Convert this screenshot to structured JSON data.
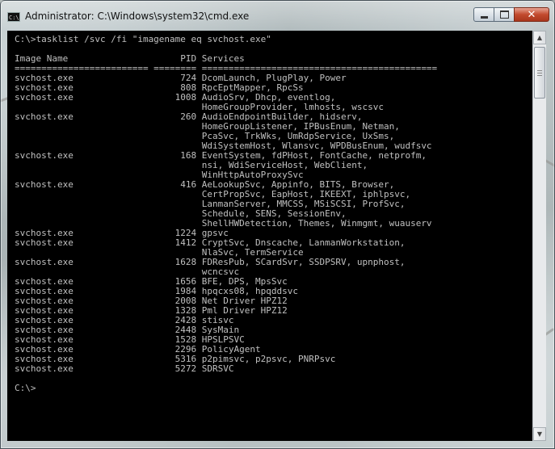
{
  "window": {
    "title": "Administrator: C:\\Windows\\system32\\cmd.exe",
    "icon": "cmd-console-icon",
    "icon_label": "C:\\"
  },
  "caption_buttons": {
    "minimize_icon": "minimize-icon",
    "maximize_icon": "maximize-icon",
    "close_icon": "close-icon",
    "close_glyph": "✕"
  },
  "console": {
    "lines": [
      "C:\\>tasklist /svc /fi \"imagename eq svchost.exe\"",
      "",
      "Image Name                     PID Services",
      "========================= ======== ============================================",
      "svchost.exe                    724 DcomLaunch, PlugPlay, Power",
      "svchost.exe                    808 RpcEptMapper, RpcSs",
      "svchost.exe                   1008 AudioSrv, Dhcp, eventlog,",
      "                                   HomeGroupProvider, lmhosts, wscsvc",
      "svchost.exe                    260 AudioEndpointBuilder, hidserv,",
      "                                   HomeGroupListener, IPBusEnum, Netman,",
      "                                   PcaSvc, TrkWks, UmRdpService, UxSms,",
      "                                   WdiSystemHost, Wlansvc, WPDBusEnum, wudfsvc",
      "svchost.exe                    168 EventSystem, fdPHost, FontCache, netprofm,",
      "                                   nsi, WdiServiceHost, WebClient,",
      "                                   WinHttpAutoProxySvc",
      "svchost.exe                    416 AeLookupSvc, Appinfo, BITS, Browser,",
      "                                   CertPropSvc, EapHost, IKEEXT, iphlpsvc,",
      "                                   LanmanServer, MMCSS, MSiSCSI, ProfSvc,",
      "                                   Schedule, SENS, SessionEnv,",
      "                                   ShellHWDetection, Themes, Winmgmt, wuauserv",
      "svchost.exe                   1224 gpsvc",
      "svchost.exe                   1412 CryptSvc, Dnscache, LanmanWorkstation,",
      "                                   NlaSvc, TermService",
      "svchost.exe                   1628 FDResPub, SCardSvr, SSDPSRV, upnphost,",
      "                                   wcncsvc",
      "svchost.exe                   1656 BFE, DPS, MpsSvc",
      "svchost.exe                   1984 hpqcxs08, hpqddsvc",
      "svchost.exe                   2008 Net Driver HPZ12",
      "svchost.exe                   1328 Pml Driver HPZ12",
      "svchost.exe                   2428 stisvc",
      "svchost.exe                   2448 SysMain",
      "svchost.exe                   1528 HPSLPSVC",
      "svchost.exe                   2296 PolicyAgent",
      "svchost.exe                   5316 p2pimsvc, p2psvc, PNRPsvc",
      "svchost.exe                   5272 SDRSVC",
      "",
      "C:\\>"
    ]
  },
  "scrollbar": {
    "up_arrow_icon": "scroll-up-arrow-icon",
    "down_arrow_icon": "scroll-down-arrow-icon",
    "up_glyph": "▲",
    "down_glyph": "▼"
  },
  "colors": {
    "console_background": "#000000",
    "console_text": "#c0c0c0",
    "close_button": "#c24a2e"
  }
}
